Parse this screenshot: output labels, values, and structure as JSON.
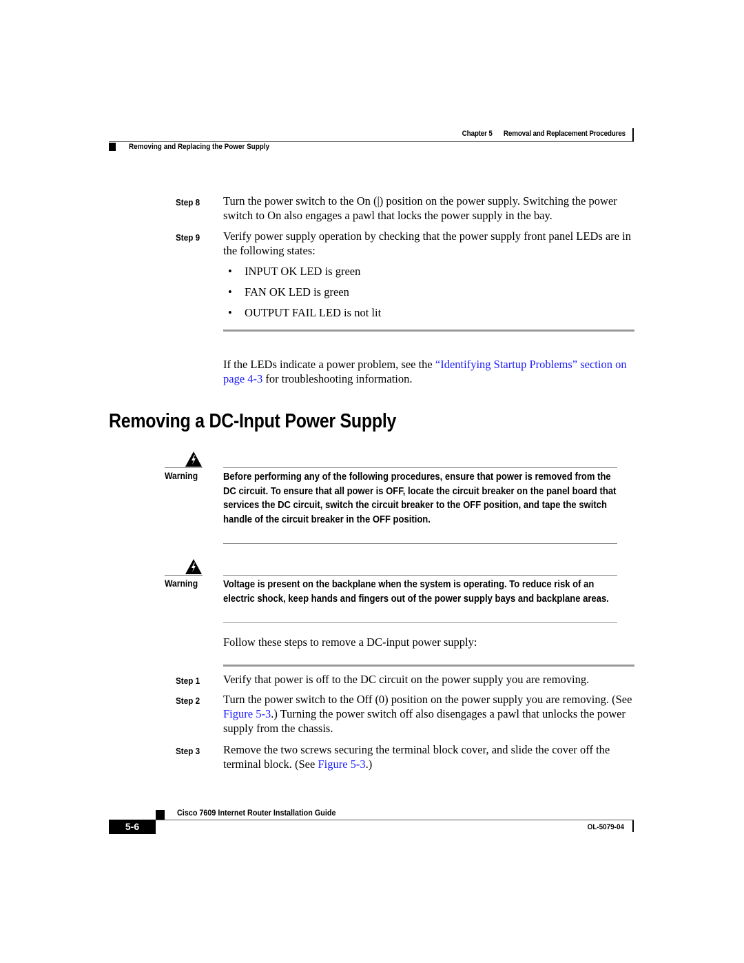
{
  "header": {
    "chapter": "Chapter 5",
    "chapter_title": "Removal and Replacement Procedures",
    "section": "Removing and Replacing the Power Supply"
  },
  "steps_top": [
    {
      "label": "Step 8",
      "text": "Turn the power switch to the On (|) position on the power supply. Switching the power switch to On also engages a pawl that locks the power supply in the bay."
    },
    {
      "label": "Step 9",
      "text": "Verify power supply operation by checking that the power supply front panel LEDs are in the following states:"
    }
  ],
  "led_states": [
    "INPUT OK LED is green",
    "FAN OK LED is green",
    "OUTPUT FAIL LED is not lit"
  ],
  "bullet_glyph": "•",
  "troubleshoot": {
    "before": "If the LEDs indicate a power problem, see the ",
    "link": "“Identifying Startup Problems” section on page 4-3",
    "after": " for troubleshooting information."
  },
  "section_heading": "Removing a DC-Input Power Supply",
  "warnings": [
    {
      "label": "Warning",
      "icon": "warning-triangle-icon",
      "text": "Before performing any of the following procedures, ensure that power is removed from the DC circuit. To ensure that all power is OFF, locate the circuit breaker on the panel board that services the DC circuit, switch the circuit breaker to the OFF position, and tape the switch handle of the circuit breaker in the OFF position."
    },
    {
      "label": "Warning",
      "icon": "warning-triangle-icon",
      "text": "Voltage is present on the backplane when the system is operating. To reduce risk of an electric shock, keep hands and fingers out of the power supply bays and backplane areas."
    }
  ],
  "intro": "Follow these steps to remove a DC-input power supply:",
  "steps_bottom": [
    {
      "label": "Step 1",
      "text": "Verify that power is off to the DC circuit on the power supply you are removing."
    },
    {
      "label": "Step 2",
      "text_before": "Turn the power switch to the Off (0) position on the power supply you are removing. (See ",
      "link": "Figure 5-3",
      "text_after": ".) Turning the power switch off also disengages a pawl that unlocks the power supply from the chassis."
    },
    {
      "label": "Step 3",
      "text_before": "Remove the two screws securing the terminal block cover, and slide the cover off the terminal block. (See ",
      "link": "Figure 5-3",
      "text_after": ".)"
    }
  ],
  "footer": {
    "guide_title": "Cisco 7609 Internet Router Installation Guide",
    "page_number": "5-6",
    "doc_id": "OL-5079-04"
  },
  "colors": {
    "link": "#1a1aff",
    "rule": "#999999"
  }
}
